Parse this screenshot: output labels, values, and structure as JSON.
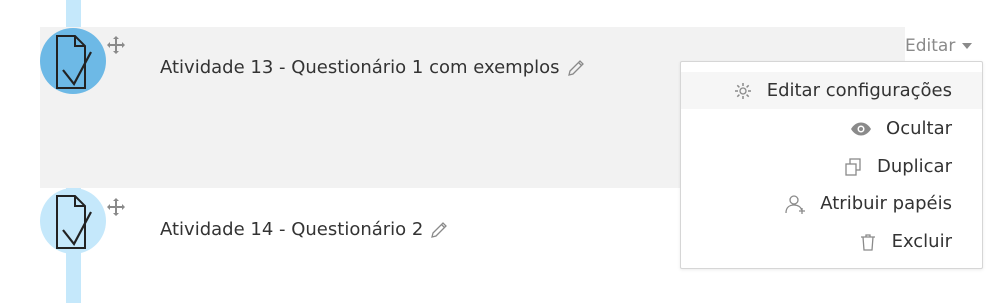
{
  "activities": [
    {
      "title": "Atividade 13 - Questionário 1 com exemplos"
    },
    {
      "title": "Atividade 14 - Questionário 2"
    }
  ],
  "edit_menu": {
    "toggle_label": "Editar",
    "items": [
      {
        "label": "Editar configurações",
        "icon": "gear-icon"
      },
      {
        "label": "Ocultar",
        "icon": "eye-icon"
      },
      {
        "label": "Duplicar",
        "icon": "duplicate-icon"
      },
      {
        "label": "Atribuir papéis",
        "icon": "user-icon"
      },
      {
        "label": "Excluir",
        "icon": "trash-icon"
      }
    ]
  },
  "colors": {
    "timeline": "#c5e8fb",
    "icon_dark": "#6db9e6",
    "row_highlight": "#f2f2f2"
  }
}
